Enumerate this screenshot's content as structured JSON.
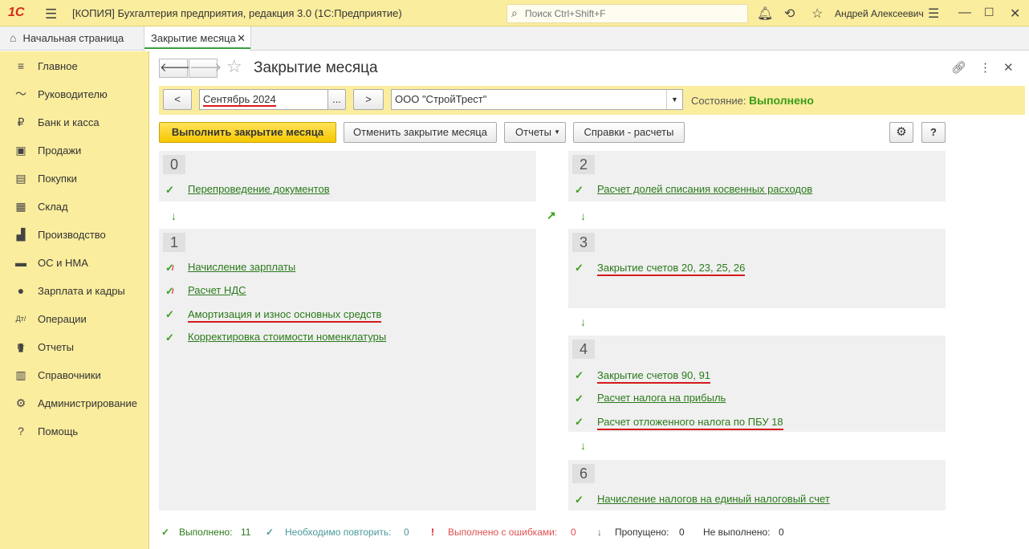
{
  "titlebar": {
    "logo": "1С",
    "title": "[КОПИЯ] Бухгалтерия предприятия, редакция 3.0  (1С:Предприятие)",
    "search_placeholder": "Поиск Ctrl+Shift+F",
    "user": "Андрей Алексеевич"
  },
  "tabs": {
    "home": "Начальная страница",
    "active": "Закрытие месяца"
  },
  "sidebar": {
    "items": [
      {
        "label": "Главное",
        "icon": "menu-lines-icon"
      },
      {
        "label": "Руководителю",
        "icon": "trend-icon"
      },
      {
        "label": "Банк и касса",
        "icon": "ruble-icon"
      },
      {
        "label": "Продажи",
        "icon": "basket-icon"
      },
      {
        "label": "Покупки",
        "icon": "cart-icon"
      },
      {
        "label": "Склад",
        "icon": "warehouse-icon"
      },
      {
        "label": "Производство",
        "icon": "factory-icon"
      },
      {
        "label": "ОС и НМА",
        "icon": "truck-icon"
      },
      {
        "label": "Зарплата и кадры",
        "icon": "person-icon"
      },
      {
        "label": "Операции",
        "icon": "dt-kt-icon"
      },
      {
        "label": "Отчеты",
        "icon": "bar-chart-icon"
      },
      {
        "label": "Справочники",
        "icon": "book-icon"
      },
      {
        "label": "Администрирование",
        "icon": "gear-icon"
      },
      {
        "label": "Помощь",
        "icon": "question-icon"
      }
    ]
  },
  "form": {
    "title": "Закрытие месяца",
    "prev_period": "<",
    "period": "Сентябрь 2024",
    "period_select": "...",
    "next_period": ">",
    "organization": "ООО \"СтройТрест\"",
    "state_label": "Состояние:",
    "state_value": "Выполнено",
    "buttons": {
      "run": "Выполнить закрытие месяца",
      "cancel": "Отменить закрытие месяца",
      "reports": "Отчеты",
      "references": "Справки - расчеты",
      "help": "?"
    }
  },
  "steps": {
    "s0": {
      "num": "0",
      "ops": [
        "Перепроведение документов"
      ]
    },
    "s1": {
      "num": "1",
      "ops": [
        "Начисление зарплаты",
        "Расчет НДС",
        "Амортизация и износ основных средств",
        "Корректировка стоимости номенклатуры"
      ]
    },
    "s2": {
      "num": "2",
      "ops": [
        "Расчет долей списания косвенных расходов"
      ]
    },
    "s3": {
      "num": "3",
      "ops": [
        "Закрытие счетов 20, 23, 25, 26"
      ]
    },
    "s4": {
      "num": "4",
      "ops": [
        "Закрытие счетов 90, 91",
        "Расчет налога на прибыль",
        "Расчет отложенного налога по ПБУ 18"
      ]
    },
    "s6": {
      "num": "6",
      "ops": [
        "Начисление налогов на единый налоговый счет"
      ]
    }
  },
  "footer": {
    "done_label": "Выполнено:",
    "done_count": "11",
    "repeat_label": "Необходимо повторить:",
    "repeat_count": "0",
    "errors_label": "Выполнено с ошибками:",
    "errors_count": "0",
    "skipped_label": "Пропущено:",
    "skipped_count": "0",
    "notdone_label": "Не выполнено:",
    "notdone_count": "0"
  },
  "colors": {
    "accent_yellow": "#fbed9e",
    "done_green": "#3a9d1a",
    "error_red": "#d61a1a",
    "repeat_teal": "#4a9a9a"
  }
}
